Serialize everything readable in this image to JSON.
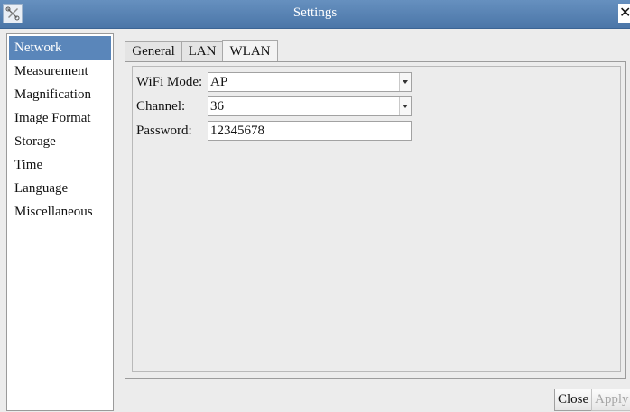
{
  "window": {
    "title": "Settings",
    "app_icon": "tools-icon",
    "close_glyph": "✕"
  },
  "sidebar": {
    "items": [
      {
        "label": "Network",
        "selected": true
      },
      {
        "label": "Measurement"
      },
      {
        "label": "Magnification"
      },
      {
        "label": "Image Format"
      },
      {
        "label": "Storage"
      },
      {
        "label": "Time"
      },
      {
        "label": "Language"
      },
      {
        "label": "Miscellaneous"
      }
    ]
  },
  "tabs": [
    {
      "label": "General"
    },
    {
      "label": "LAN"
    },
    {
      "label": "WLAN",
      "active": true
    }
  ],
  "wlan": {
    "wifi_mode": {
      "label": "WiFi Mode:",
      "value": "AP"
    },
    "channel": {
      "label": "Channel:",
      "value": "36"
    },
    "password": {
      "label": "Password:",
      "value": "12345678"
    }
  },
  "footer": {
    "close_label": "Close",
    "apply_label": "Apply"
  },
  "colors": {
    "titlebar": "#4b76a8",
    "selection": "#5a86ba"
  }
}
